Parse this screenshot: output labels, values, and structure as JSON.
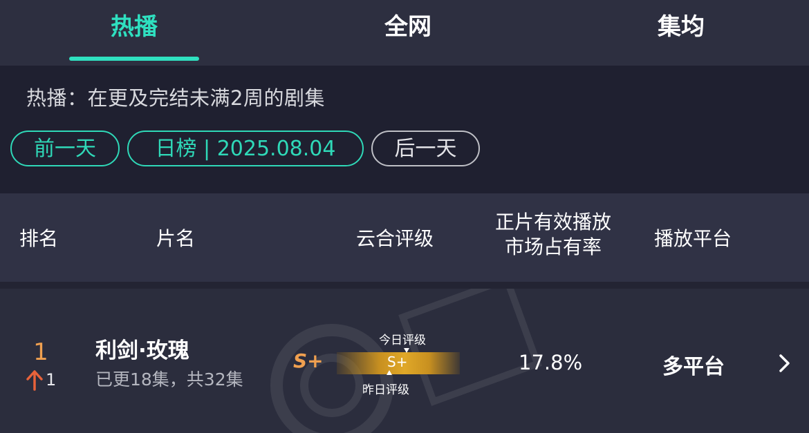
{
  "tabs": [
    {
      "label": "热播",
      "active": true
    },
    {
      "label": "全网",
      "active": false
    },
    {
      "label": "集均",
      "active": false
    }
  ],
  "filter": {
    "description": "热播：在更及完结未满2周的剧集",
    "prev_label": "前一天",
    "date_label": "日榜 | 2025.08.04",
    "next_label": "后一天"
  },
  "table_header": {
    "rank": "排名",
    "title": "片名",
    "rating": "云合评级",
    "share_line1": "正片有效播放",
    "share_line2": "市场占有率",
    "platform": "播放平台"
  },
  "rows": [
    {
      "rank": "1",
      "rank_change": "1",
      "title": "利剑·玫瑰",
      "episodes": "已更18集，共32集",
      "grade": "S+",
      "grade_bar_label": "S+",
      "today_label": "今日评级",
      "yesterday_label": "昨日评级",
      "share": "17.8%",
      "platform": "多平台"
    }
  ],
  "colors": {
    "accent": "#2fe0c0",
    "rank": "#f0a050",
    "rank_up_arrow": "#e8623a",
    "grade_bar": "#e0a828",
    "background": "#2b2d3d"
  },
  "icons": {
    "rank_change": "arrow-up-icon",
    "row_action": "chevron-right-icon"
  }
}
